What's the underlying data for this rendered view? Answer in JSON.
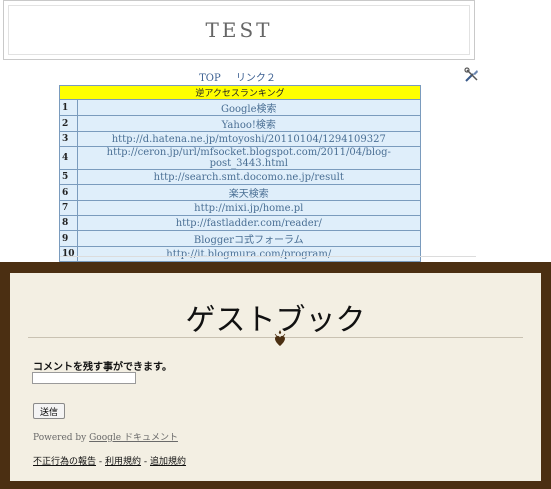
{
  "header": {
    "title": "TEST"
  },
  "nav": {
    "items": [
      "TOP",
      "リンク２"
    ]
  },
  "ranking": {
    "title": "逆アクセスランキング",
    "rows": [
      {
        "num": "1",
        "text": "Google検索"
      },
      {
        "num": "2",
        "text": "Yahoo!検索"
      },
      {
        "num": "3",
        "text": "http://d.hatena.ne.jp/mtoyoshi/20110104/1294109327"
      },
      {
        "num": "4",
        "text": "http://ceron.jp/url/mfsocket.blogspot.com/2011/04/blog-post_3443.html"
      },
      {
        "num": "5",
        "text": "http://search.smt.docomo.ne.jp/result"
      },
      {
        "num": "6",
        "text": "楽天検索"
      },
      {
        "num": "7",
        "text": "http://mixi.jp/home.pl"
      },
      {
        "num": "8",
        "text": "http://fastladder.com/reader/"
      },
      {
        "num": "9",
        "text": "Bloggerコ式フォーラム"
      },
      {
        "num": "10",
        "text": "http://it.blogmura.com/program/"
      }
    ]
  },
  "guestbook": {
    "title": "ゲストブック",
    "comment_label": "コメントを残す事ができます。",
    "comment_value": "",
    "send_label": "送信",
    "powered_prefix": "Powered by ",
    "powered_link": "Google ドキュメント",
    "footer_links": [
      "不正行為の報告",
      "利用規約",
      "追加規約"
    ],
    "separator": " - "
  },
  "colors": {
    "frame": "#4b2f12",
    "guestbook_bg": "#f3efe3",
    "ranking_header": "#ffff00",
    "ranking_cell": "#dfeefa",
    "link": "#3b5f91"
  },
  "icons": {
    "tools": "tools-icon",
    "heart": "heart-ornament-icon"
  }
}
